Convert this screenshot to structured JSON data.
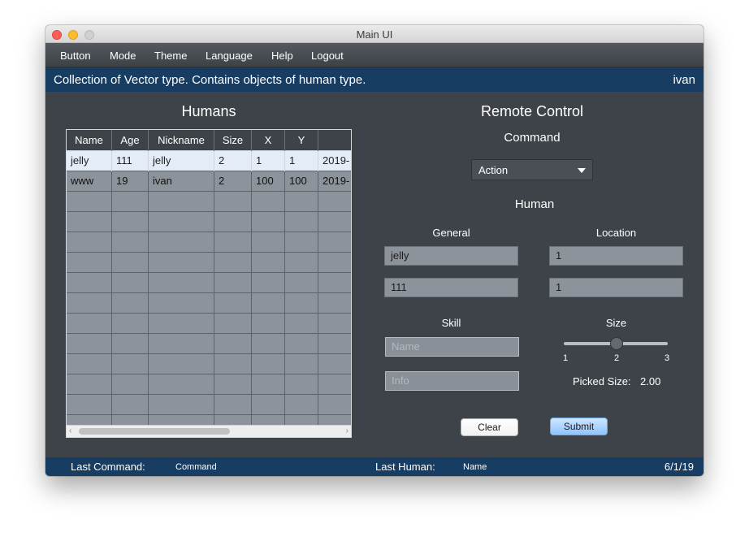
{
  "window": {
    "title": "Main UI"
  },
  "menu": [
    "Button",
    "Mode",
    "Theme",
    "Language",
    "Help",
    "Logout"
  ],
  "info": {
    "text": "Collection of Vector type. Contains objects of human type.",
    "user": "ivan"
  },
  "humans": {
    "title": "Humans",
    "columns": [
      "Name",
      "Age",
      "Nickname",
      "Size",
      "X",
      "Y",
      ""
    ],
    "rows": [
      [
        "jelly",
        "111",
        "jelly",
        "2",
        "1",
        "1",
        "2019-"
      ],
      [
        "www",
        "19",
        "ivan",
        "2",
        "100",
        "100",
        "2019-"
      ]
    ]
  },
  "remote": {
    "title": "Remote Control",
    "command_label": "Command",
    "command_value": "Action",
    "human_label": "Human",
    "general_label": "General",
    "location_label": "Location",
    "general_name": "jelly",
    "general_age": "111",
    "location_x": "1",
    "location_y": "1",
    "skill_label": "Skill",
    "skill_name_placeholder": "Name",
    "skill_info_placeholder": "Info",
    "size_label": "Size",
    "size_ticks": [
      "1",
      "2",
      "3"
    ],
    "size_value": 2,
    "picked_size_label": "Picked Size:",
    "picked_size_value": "2.00",
    "clear_label": "Clear",
    "submit_label": "Submit"
  },
  "status": {
    "last_command_label": "Last Command:",
    "last_command_value": "Command",
    "last_human_label": "Last Human:",
    "last_human_value": "Name",
    "date": "6/1/19"
  }
}
